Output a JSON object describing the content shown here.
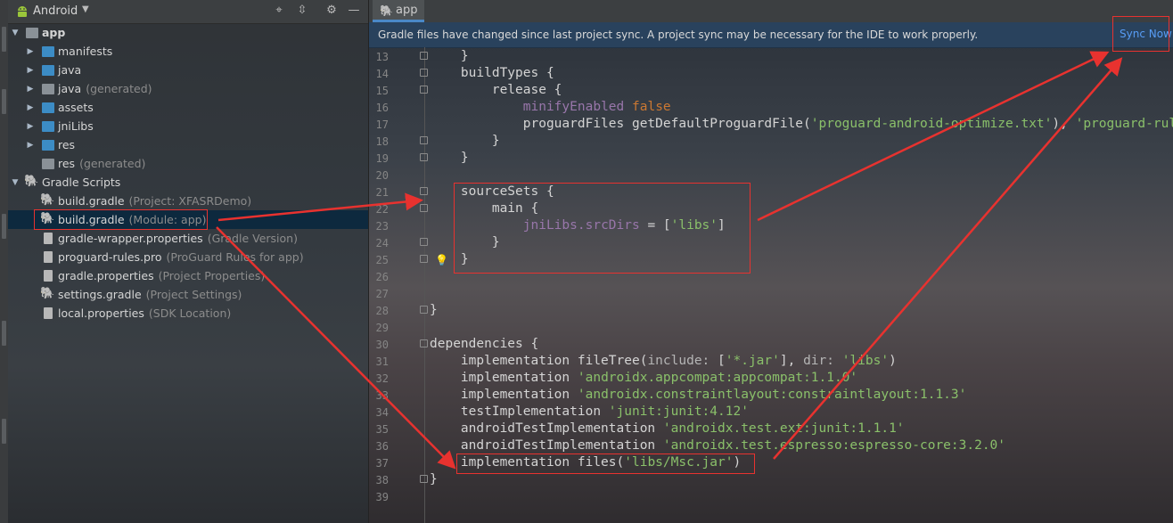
{
  "colors": {
    "accent_blue": "#589df6",
    "annotation_red": "#e8322f",
    "keyword_orange": "#cc7832",
    "string_green": "#8ac06a",
    "property_purple": "#9876aa"
  },
  "project_panel": {
    "title": "Android",
    "icons": [
      "android-icon",
      "crosshair-icon",
      "collapse-icon",
      "gear-icon",
      "minimize-icon"
    ],
    "tree": [
      {
        "label": "app",
        "meta": "",
        "icon": "folder-icon",
        "expanded": true,
        "level": 0
      },
      {
        "label": "manifests",
        "meta": "",
        "icon": "folder-icon",
        "expanded": false,
        "level": 1
      },
      {
        "label": "java",
        "meta": "",
        "icon": "folder-icon",
        "expanded": false,
        "level": 1
      },
      {
        "label": "java",
        "meta": "(generated)",
        "icon": "folder-generated-icon",
        "expanded": false,
        "level": 1
      },
      {
        "label": "assets",
        "meta": "",
        "icon": "folder-icon",
        "expanded": false,
        "level": 1
      },
      {
        "label": "jniLibs",
        "meta": "",
        "icon": "folder-icon",
        "expanded": false,
        "level": 1
      },
      {
        "label": "res",
        "meta": "",
        "icon": "folder-icon",
        "expanded": false,
        "level": 1
      },
      {
        "label": "res",
        "meta": "(generated)",
        "icon": "folder-generated-icon",
        "expanded": false,
        "level": 1
      },
      {
        "label": "Gradle Scripts",
        "meta": "",
        "icon": "gradle-icon",
        "expanded": true,
        "level": 0
      },
      {
        "label": "build.gradle",
        "meta": "(Project: XFASRDemo)",
        "icon": "gradle-icon",
        "level": 1
      },
      {
        "label": "build.gradle",
        "meta": "(Module: app)",
        "icon": "gradle-icon",
        "level": 1,
        "selected": true
      },
      {
        "label": "gradle-wrapper.properties",
        "meta": "(Gradle Version)",
        "icon": "properties-file-icon",
        "level": 1
      },
      {
        "label": "proguard-rules.pro",
        "meta": "(ProGuard Rules for app)",
        "icon": "file-icon",
        "level": 1
      },
      {
        "label": "gradle.properties",
        "meta": "(Project Properties)",
        "icon": "properties-file-icon",
        "level": 1
      },
      {
        "label": "settings.gradle",
        "meta": "(Project Settings)",
        "icon": "gradle-icon",
        "level": 1
      },
      {
        "label": "local.properties",
        "meta": "(SDK Location)",
        "icon": "properties-file-icon",
        "level": 1
      }
    ]
  },
  "editor": {
    "tab_label": "app",
    "banner": {
      "message": "Gradle files have changed since last project sync. A project sync may be necessary for the IDE to work properly.",
      "action": "Sync Now"
    },
    "lines": [
      {
        "n": "13",
        "segments": [
          {
            "t": "    }",
            "c": ""
          }
        ]
      },
      {
        "n": "14",
        "segments": [
          {
            "t": "    buildTypes {",
            "c": ""
          }
        ]
      },
      {
        "n": "15",
        "segments": [
          {
            "t": "        release {",
            "c": ""
          }
        ]
      },
      {
        "n": "16",
        "segments": [
          {
            "t": "            ",
            "c": ""
          },
          {
            "t": "minifyEnabled",
            "c": "prop"
          },
          {
            "t": " ",
            "c": ""
          },
          {
            "t": "false",
            "c": "kw"
          }
        ]
      },
      {
        "n": "17",
        "segments": [
          {
            "t": "            proguardFiles getDefaultProguardFile(",
            "c": ""
          },
          {
            "t": "'proguard-android-optimize.txt'",
            "c": "str"
          },
          {
            "t": "), ",
            "c": ""
          },
          {
            "t": "'proguard-rules.pro'",
            "c": "str"
          }
        ]
      },
      {
        "n": "18",
        "segments": [
          {
            "t": "        }",
            "c": ""
          }
        ]
      },
      {
        "n": "19",
        "segments": [
          {
            "t": "    }",
            "c": ""
          }
        ]
      },
      {
        "n": "20",
        "segments": [
          {
            "t": "",
            "c": ""
          }
        ]
      },
      {
        "n": "21",
        "segments": [
          {
            "t": "    sourceSets {",
            "c": ""
          }
        ]
      },
      {
        "n": "22",
        "segments": [
          {
            "t": "        main {",
            "c": ""
          }
        ]
      },
      {
        "n": "23",
        "segments": [
          {
            "t": "            ",
            "c": ""
          },
          {
            "t": "jniLibs.srcDirs",
            "c": "prop"
          },
          {
            "t": " = [",
            "c": ""
          },
          {
            "t": "'libs'",
            "c": "str"
          },
          {
            "t": "]",
            "c": ""
          }
        ]
      },
      {
        "n": "24",
        "segments": [
          {
            "t": "        }",
            "c": ""
          }
        ]
      },
      {
        "n": "25",
        "segments": [
          {
            "t": "    }",
            "c": ""
          }
        ]
      },
      {
        "n": "26",
        "segments": [
          {
            "t": "",
            "c": ""
          }
        ]
      },
      {
        "n": "27",
        "segments": [
          {
            "t": "",
            "c": ""
          }
        ]
      },
      {
        "n": "28",
        "segments": [
          {
            "t": "}",
            "c": ""
          }
        ]
      },
      {
        "n": "29",
        "segments": [
          {
            "t": "",
            "c": ""
          }
        ]
      },
      {
        "n": "30",
        "segments": [
          {
            "t": "dependencies {",
            "c": ""
          }
        ]
      },
      {
        "n": "31",
        "segments": [
          {
            "t": "    implementation fileTree(",
            "c": ""
          },
          {
            "t": "include: ",
            "c": "named"
          },
          {
            "t": "[",
            "c": ""
          },
          {
            "t": "'*.jar'",
            "c": "str"
          },
          {
            "t": "], ",
            "c": ""
          },
          {
            "t": "dir: ",
            "c": "named"
          },
          {
            "t": "'libs'",
            "c": "str"
          },
          {
            "t": ")",
            "c": ""
          }
        ]
      },
      {
        "n": "32",
        "segments": [
          {
            "t": "    implementation ",
            "c": ""
          },
          {
            "t": "'androidx.appcompat:appcompat:1.1.0'",
            "c": "str"
          }
        ]
      },
      {
        "n": "33",
        "segments": [
          {
            "t": "    implementation ",
            "c": ""
          },
          {
            "t": "'androidx.constraintlayout:constraintlayout:1.1.3'",
            "c": "str"
          }
        ]
      },
      {
        "n": "34",
        "segments": [
          {
            "t": "    testImplementation ",
            "c": ""
          },
          {
            "t": "'junit:junit:4.12'",
            "c": "str"
          }
        ]
      },
      {
        "n": "35",
        "segments": [
          {
            "t": "    androidTestImplementation ",
            "c": ""
          },
          {
            "t": "'androidx.test.ext:junit:1.1.1'",
            "c": "str"
          }
        ]
      },
      {
        "n": "36",
        "segments": [
          {
            "t": "    androidTestImplementation ",
            "c": ""
          },
          {
            "t": "'androidx.test.espresso:espresso-core:3.2.0'",
            "c": "str"
          }
        ]
      },
      {
        "n": "37",
        "segments": [
          {
            "t": "    implementation files(",
            "c": ""
          },
          {
            "t": "'libs/Msc.jar'",
            "c": "str"
          },
          {
            "t": ")",
            "c": ""
          }
        ]
      },
      {
        "n": "38",
        "segments": [
          {
            "t": "}",
            "c": ""
          }
        ]
      },
      {
        "n": "39",
        "segments": [
          {
            "t": "",
            "c": ""
          }
        ]
      }
    ]
  }
}
